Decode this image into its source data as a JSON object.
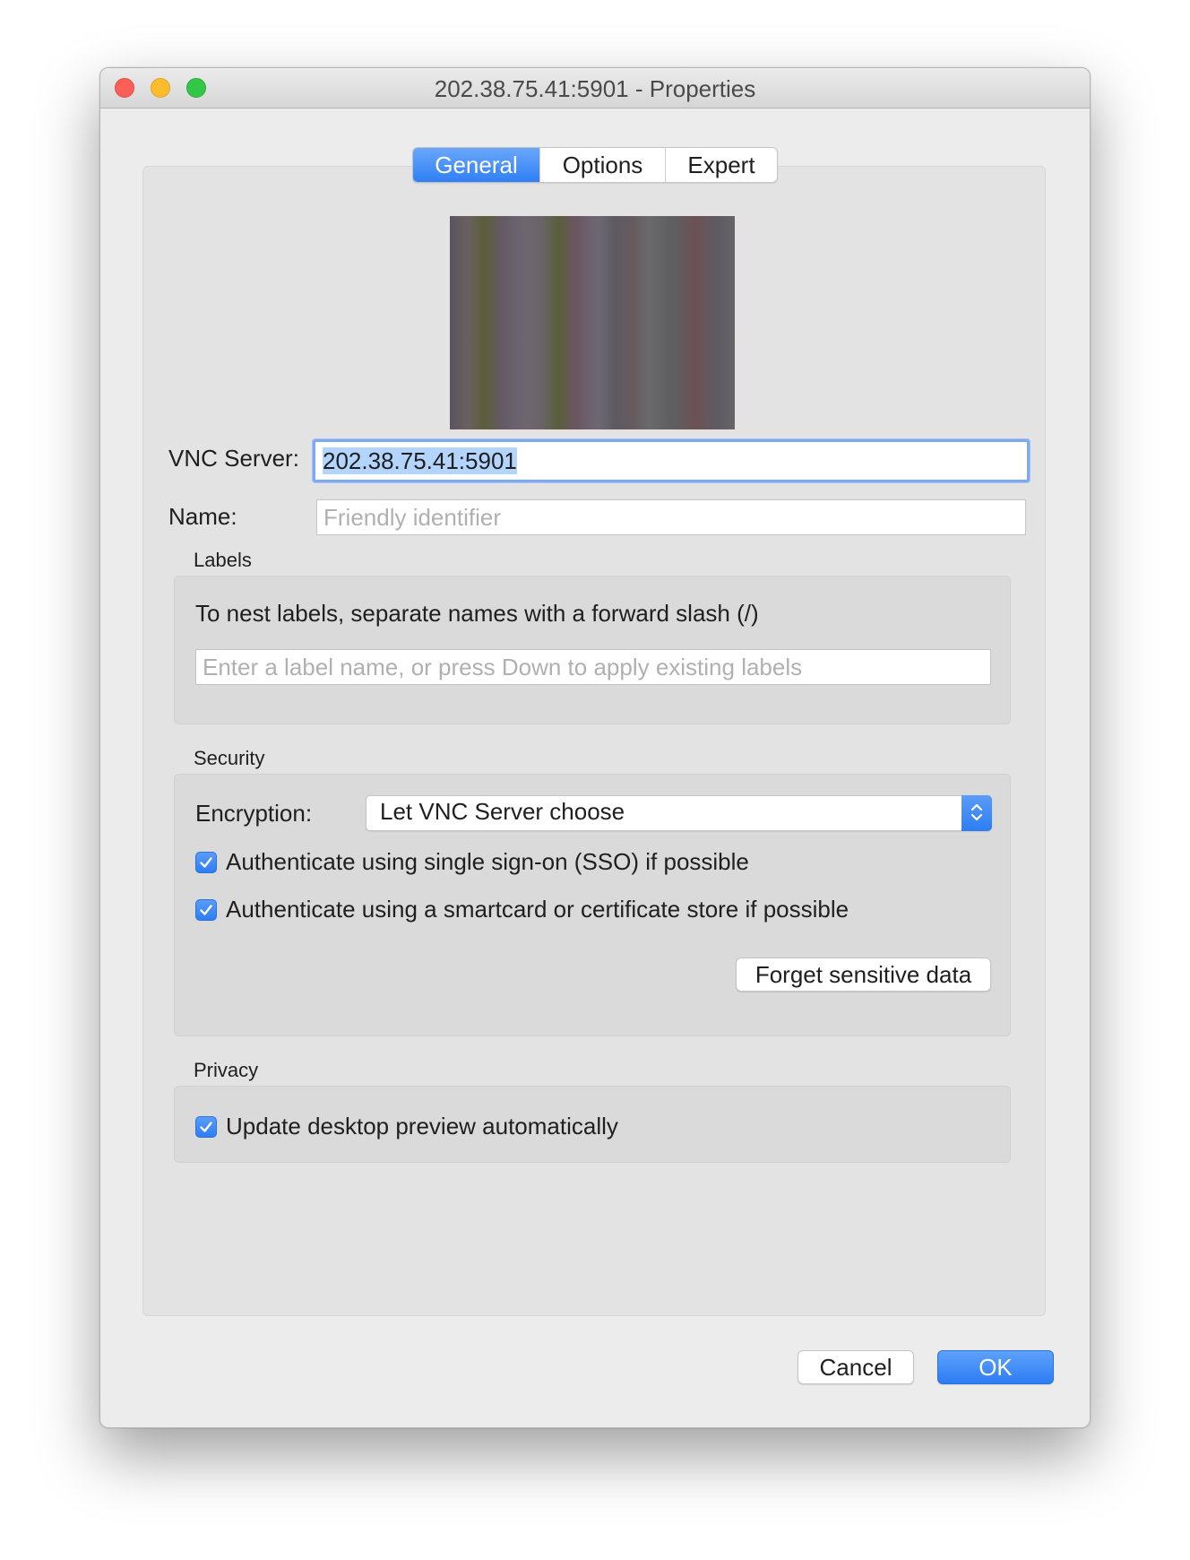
{
  "window": {
    "title": "202.38.75.41:5901 - Properties"
  },
  "tabs": [
    {
      "label": "General",
      "active": true
    },
    {
      "label": "Options",
      "active": false
    },
    {
      "label": "Expert",
      "active": false
    }
  ],
  "general": {
    "vnc_server_label": "VNC Server:",
    "vnc_server_value": "202.38.75.41:5901",
    "name_label": "Name:",
    "name_placeholder": "Friendly identifier"
  },
  "labels_section": {
    "title": "Labels",
    "hint": "To nest labels, separate names with a forward slash (/)",
    "input_placeholder": "Enter a label name, or press Down to apply existing labels"
  },
  "security": {
    "title": "Security",
    "encryption_label": "Encryption:",
    "encryption_value": "Let VNC Server choose",
    "sso_label": "Authenticate using single sign-on (SSO) if possible",
    "sso_checked": true,
    "smartcard_label": "Authenticate using a smartcard or certificate store if possible",
    "smartcard_checked": true,
    "forget_button": "Forget sensitive data"
  },
  "privacy": {
    "title": "Privacy",
    "update_preview_label": "Update desktop preview automatically",
    "update_preview_checked": true
  },
  "footer": {
    "cancel_label": "Cancel",
    "ok_label": "OK"
  },
  "colors": {
    "accent": "#2f7ff5",
    "window_bg": "#ececec",
    "close": "#fc5f57",
    "minimize": "#fdbc2e",
    "maximize": "#33c748"
  }
}
